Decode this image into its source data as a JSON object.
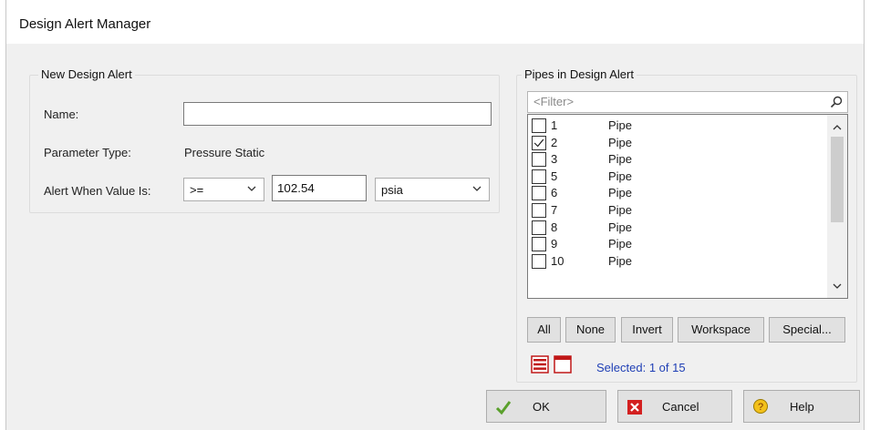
{
  "window": {
    "title": "Design Alert Manager"
  },
  "new_alert": {
    "group_label": "New Design Alert",
    "name_label": "Name:",
    "name_value": "",
    "param_label": "Parameter Type:",
    "param_value": "Pressure Static",
    "alert_label": "Alert When Value Is:",
    "operator": ">=",
    "value": "102.54",
    "unit": "psia"
  },
  "pipes": {
    "group_label": "Pipes in Design Alert",
    "filter_placeholder": "<Filter>",
    "items": [
      {
        "num": "1",
        "type": "Pipe",
        "checked": false
      },
      {
        "num": "2",
        "type": "Pipe",
        "checked": true
      },
      {
        "num": "3",
        "type": "Pipe",
        "checked": false
      },
      {
        "num": "5",
        "type": "Pipe",
        "checked": false
      },
      {
        "num": "6",
        "type": "Pipe",
        "checked": false
      },
      {
        "num": "7",
        "type": "Pipe",
        "checked": false
      },
      {
        "num": "8",
        "type": "Pipe",
        "checked": false
      },
      {
        "num": "9",
        "type": "Pipe",
        "checked": false
      },
      {
        "num": "10",
        "type": "Pipe",
        "checked": false
      }
    ],
    "buttons": {
      "all": "All",
      "none": "None",
      "invert": "Invert",
      "workspace": "Workspace",
      "special": "Special..."
    },
    "selected_text": "Selected: 1 of 15"
  },
  "footer": {
    "ok": "OK",
    "cancel": "Cancel",
    "help": "Help"
  },
  "colors": {
    "accent_text": "#1f3fb5",
    "ok_check": "#5aa02c",
    "cancel_red": "#d32020",
    "help_yellow": "#f3c11b"
  }
}
